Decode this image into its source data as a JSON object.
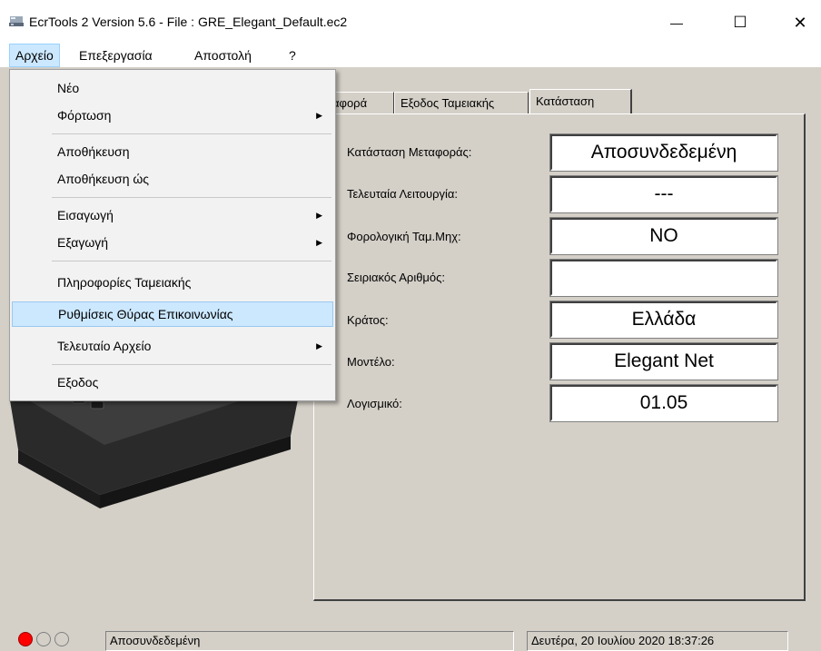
{
  "window": {
    "title": "EcrTools 2 Version 5.6 -   File :  GRE_Elegant_Default.ec2",
    "minimize_glyph": "—",
    "maximize_glyph": "☐",
    "close_glyph": "✕"
  },
  "menubar": {
    "items": [
      {
        "label": "Αρχείο",
        "active": true
      },
      {
        "label": "Επεξεργασία"
      },
      {
        "label": "Αποστολή"
      },
      {
        "label": "?"
      }
    ]
  },
  "file_menu": {
    "items": [
      {
        "label": "Νέο",
        "submenu": false
      },
      {
        "label": "Φόρτωση",
        "submenu": true
      },
      {
        "label": "Αποθήκευση",
        "submenu": false
      },
      {
        "label": "Αποθήκευση ώς",
        "submenu": false
      },
      {
        "label": "Εισαγωγή",
        "submenu": true
      },
      {
        "label": "Εξαγωγή",
        "submenu": true
      },
      {
        "label": "Πληροφορίες Ταμειακής",
        "submenu": false
      },
      {
        "label": "Ρυθμίσεις Θύρας Επικοινωνίας",
        "submenu": false,
        "highlighted": true
      },
      {
        "label": "Τελευταίο Αρχείο",
        "submenu": true
      },
      {
        "label": "Εξοδος",
        "submenu": false
      }
    ],
    "submenu_glyph": "▶"
  },
  "tabs": [
    {
      "label": "αφορά"
    },
    {
      "label": "Εξοδος Ταμειακής"
    },
    {
      "label": "Κατάσταση",
      "active": true
    }
  ],
  "status_panel": {
    "rows": [
      {
        "label": "Κατάσταση Μεταφοράς:",
        "value": "Αποσυνδεδεμένη"
      },
      {
        "label": "Τελευταία Λειτουργία:",
        "value": "---"
      },
      {
        "label": "Φορολογική Ταμ.Μηχ:",
        "value": "ΝΟ"
      },
      {
        "label": "Σειριακός Αριθμός:",
        "value": ""
      },
      {
        "label": "Κράτος:",
        "value": "Ελλάδα"
      },
      {
        "label": "Μοντέλο:",
        "value": "Elegant Net"
      },
      {
        "label": "Λογισμικό:",
        "value": "01.05"
      }
    ]
  },
  "statusbar": {
    "connection_text": "Αποσυνδεδεμένη",
    "datetime": "Δευτέρα,  20 Ιουλίου 2020  18:37:26",
    "led_colors": [
      "#ff0000",
      "#d4d0c8",
      "#d4d0c8"
    ]
  }
}
